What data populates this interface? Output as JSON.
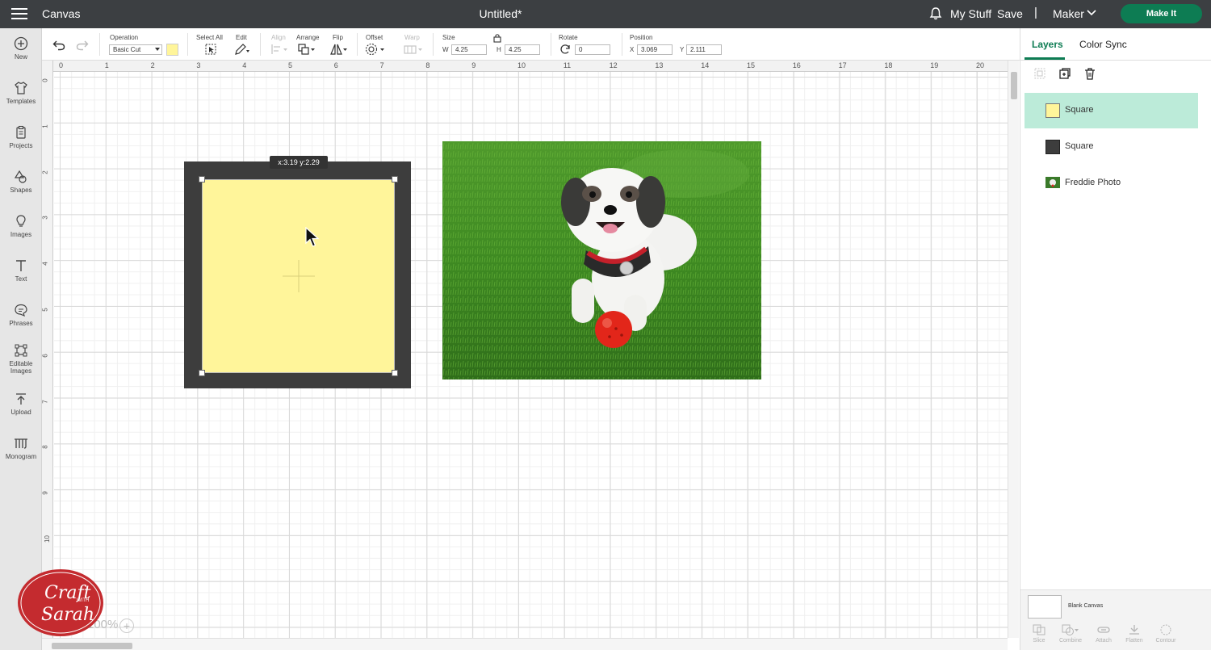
{
  "topbar": {
    "app_title": "Canvas",
    "doc_title": "Untitled*",
    "my_stuff": "My Stuff",
    "save": "Save",
    "separator": "|",
    "machine": "Maker",
    "make_it": "Make It"
  },
  "sidebar": {
    "items": [
      {
        "label": "New",
        "icon": "plus-circle-icon"
      },
      {
        "label": "Templates",
        "icon": "shirt-icon"
      },
      {
        "label": "Projects",
        "icon": "clipboard-icon"
      },
      {
        "label": "Shapes",
        "icon": "shapes-icon"
      },
      {
        "label": "Images",
        "icon": "bulb-icon"
      },
      {
        "label": "Text",
        "icon": "text-icon"
      },
      {
        "label": "Phrases",
        "icon": "chat-icon"
      },
      {
        "label": "Editable",
        "label2": "Images",
        "icon": "edit-image-icon"
      },
      {
        "label": "Upload",
        "icon": "upload-icon"
      },
      {
        "label": "Monogram",
        "icon": "monogram-icon"
      }
    ]
  },
  "toolbar": {
    "operation_label": "Operation",
    "operation_value": "Basic Cut",
    "select_all": "Select All",
    "edit": "Edit",
    "align": "Align",
    "arrange": "Arrange",
    "flip": "Flip",
    "offset": "Offset",
    "warp": "Warp",
    "size": "Size",
    "w_label": "W",
    "w_value": "4.25",
    "h_label": "H",
    "h_value": "4.25",
    "rotate": "Rotate",
    "rotate_value": "0",
    "position": "Position",
    "x_label": "X",
    "x_value": "3.069",
    "y_label": "Y",
    "y_value": "2.111",
    "swatch_color": "#fff59a"
  },
  "rulers": {
    "top": [
      "0",
      "1",
      "2",
      "3",
      "4",
      "5",
      "6",
      "7",
      "8",
      "9",
      "10",
      "11",
      "12",
      "13",
      "14",
      "15",
      "16",
      "17",
      "18",
      "19",
      "20"
    ],
    "left": [
      "0",
      "1",
      "2",
      "3",
      "4",
      "5",
      "6",
      "7",
      "8",
      "9",
      "10"
    ]
  },
  "canvas": {
    "coord_tooltip": "x:3.19 y:2.29",
    "zoom": "100%"
  },
  "logo": {
    "line1": "Craft",
    "line2": "WITH",
    "line3": "Sarah"
  },
  "panel": {
    "tabs": [
      "Layers",
      "Color Sync"
    ],
    "layers": [
      {
        "name": "Square",
        "color": "#fff59a",
        "selected": true
      },
      {
        "name": "Square",
        "color": "#3d3d3d",
        "selected": false
      },
      {
        "name": "Freddie Photo",
        "color": "#3a7a2a",
        "selected": false
      }
    ],
    "blank_canvas": "Blank Canvas",
    "bottom_tools": [
      "Slice",
      "Combine",
      "Attach",
      "Flatten",
      "Contour"
    ]
  },
  "colors": {
    "topbar": "#3c3f42",
    "accent": "#0d7c53",
    "selected_layer": "#bcebd9",
    "yellow": "#fff59a",
    "dark": "#3d3d3d"
  }
}
